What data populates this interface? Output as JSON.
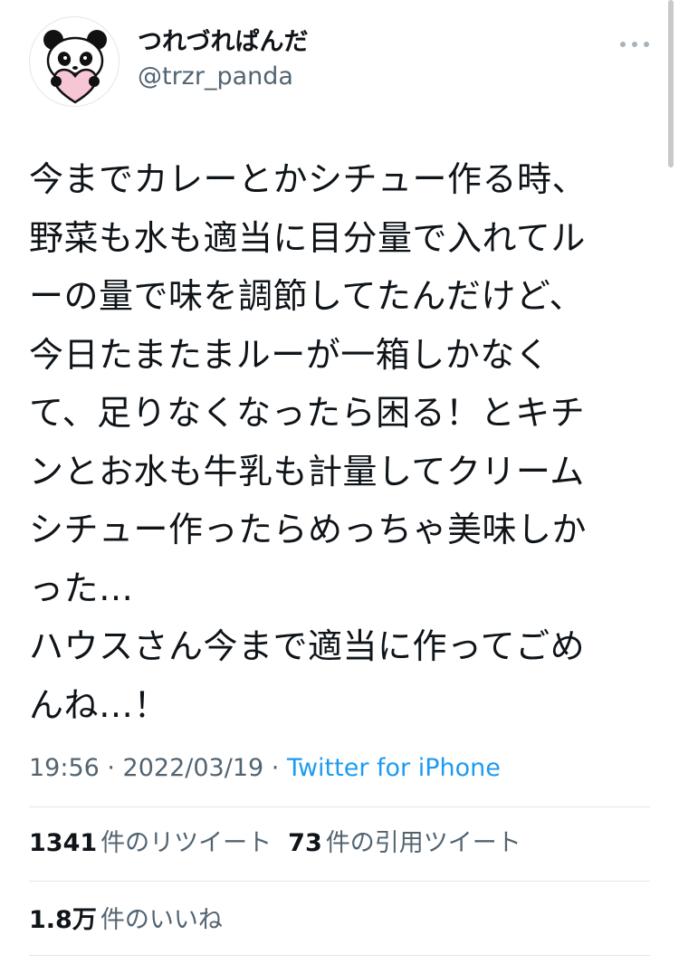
{
  "author": {
    "display_name": "つれづれぱんだ",
    "handle": "@trzr_panda",
    "avatar_icon": "panda-holding-heart-icon"
  },
  "tweet": {
    "text": "今までカレーとかシチュー作る時、\n野菜も水も適当に目分量で入れてル\nーの量で味を調節してたんだけど、\n今日たまたまルーが一箱しかなく\nて、足りなくなったら困る！とキチ\nンとお水も牛乳も計量してクリーム\nシチュー作ったらめっちゃ美味しか\nった…\nハウスさん今まで適当に作ってごめ\nんね…！",
    "timestamp": "19:56 · 2022/03/19 · ",
    "source": "Twitter for iPhone"
  },
  "stats": {
    "retweets": {
      "count": "1341",
      "label": "件のリツイート"
    },
    "quotes": {
      "count": "73",
      "label": "件の引用ツイート"
    },
    "likes": {
      "count": "1.8万",
      "label": "件のいいね"
    }
  },
  "colors": {
    "text": "#0f1419",
    "secondary": "#536471",
    "link": "#1d9bf0",
    "divider": "#e1e8ed",
    "heart": "#f7c6d4"
  }
}
